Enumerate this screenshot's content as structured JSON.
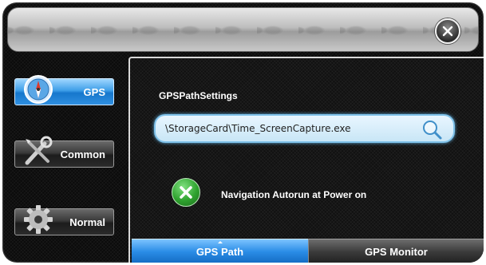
{
  "window": {
    "close_icon": "close-icon"
  },
  "sidebar": {
    "items": [
      {
        "label": "GPS",
        "icon": "compass-icon",
        "active": true
      },
      {
        "label": "Common",
        "icon": "tools-icon",
        "active": false
      },
      {
        "label": "Normal",
        "icon": "gear-icon",
        "active": false
      }
    ]
  },
  "content": {
    "section_title": "GPSPathSettings",
    "path_value": "\\StorageCard\\Time_ScreenCapture.exe",
    "search_icon": "search-icon",
    "autorun": {
      "label": "Navigation Autorun at Power on",
      "checked": false,
      "icon": "x-toggle-icon"
    }
  },
  "tabs": [
    {
      "label": "GPS Path",
      "active": true
    },
    {
      "label": "GPS Monitor",
      "active": false
    }
  ],
  "colors": {
    "accent_blue": "#2a8ce6",
    "toggle_green": "#2fa22f"
  }
}
